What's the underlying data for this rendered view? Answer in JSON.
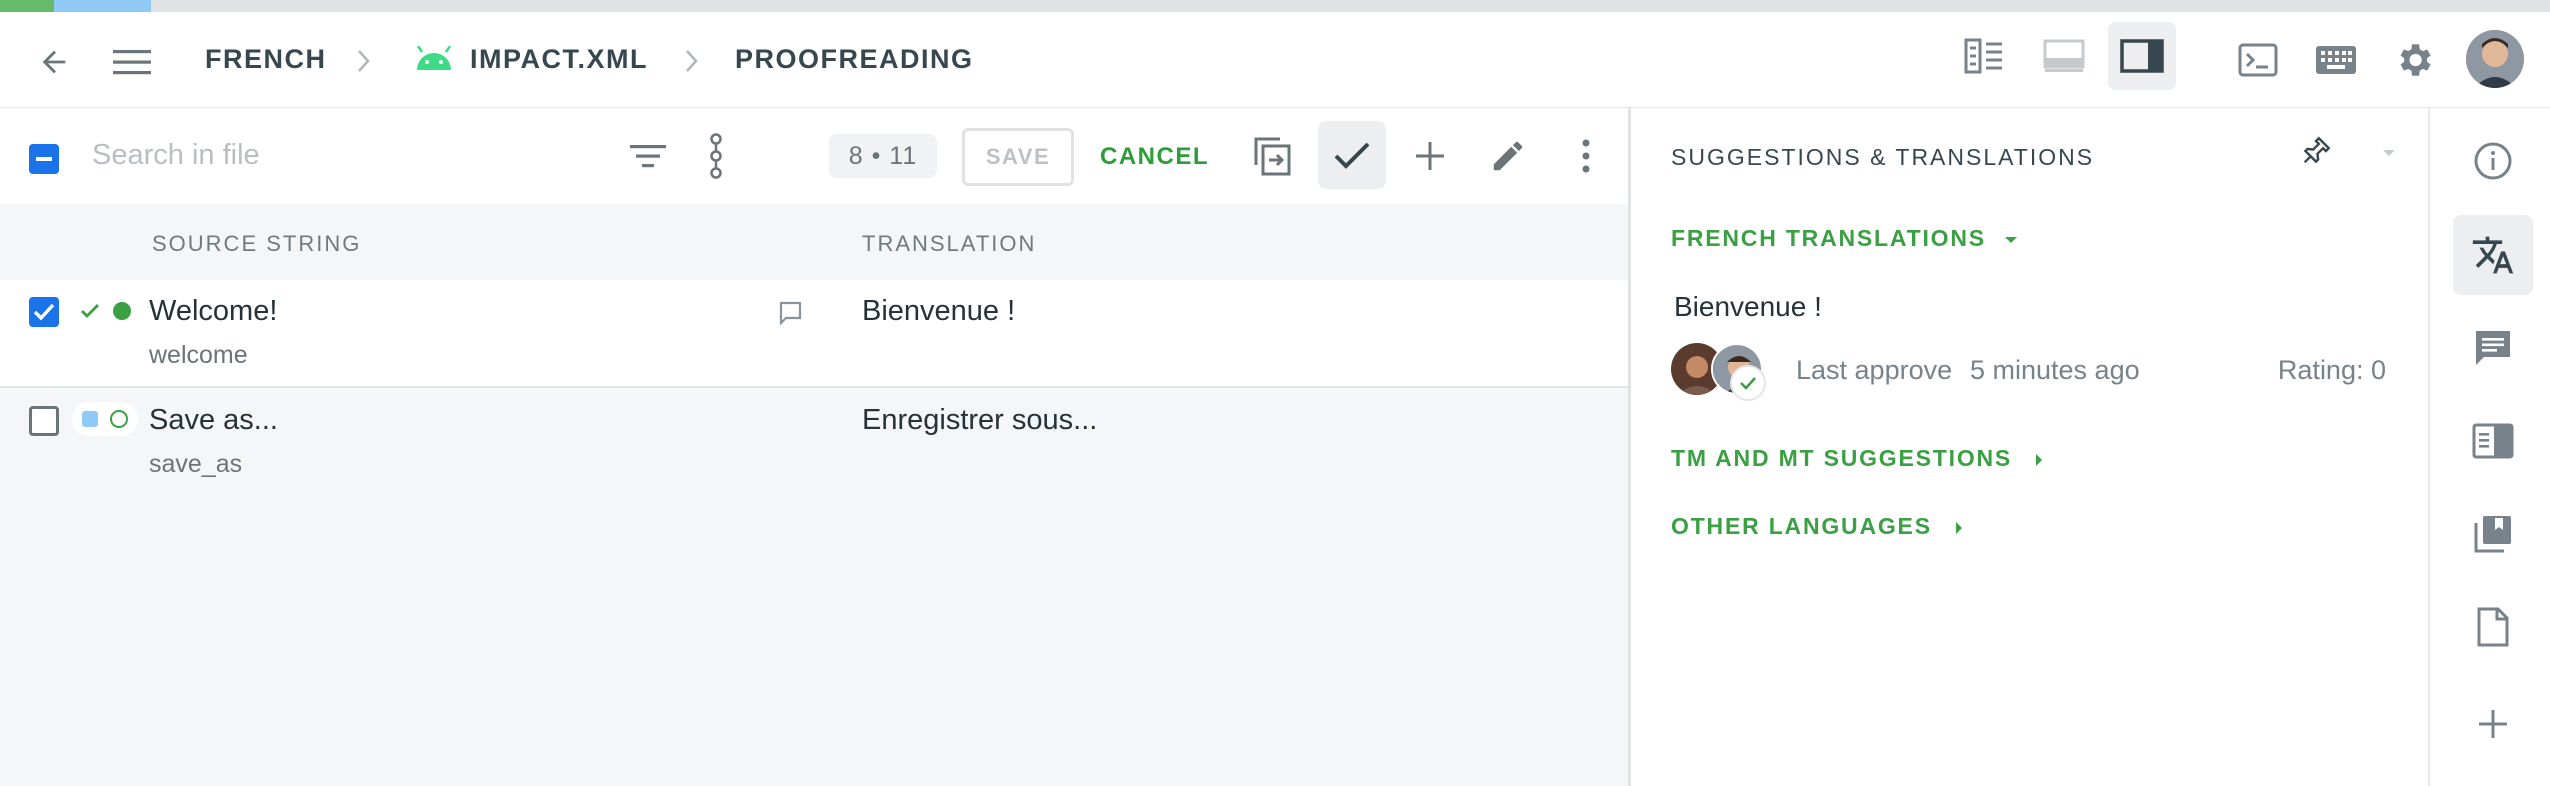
{
  "progress": {
    "translated_fraction": 0.021,
    "approved_fraction": 0.038
  },
  "breadcrumb": {
    "language": "FRENCH",
    "file": "IMPACT.XML",
    "step": "PROOFREADING"
  },
  "toolbar": {
    "search_placeholder": "Search in file",
    "counter": "8 • 11",
    "save_label": "SAVE",
    "cancel_label": "CANCEL"
  },
  "table": {
    "headers": {
      "source": "SOURCE STRING",
      "translation": "TRANSLATION"
    },
    "rows": [
      {
        "source": "Welcome!",
        "key": "welcome",
        "translation": "Bienvenue !",
        "checked": true
      },
      {
        "source": "Save as...",
        "key": "save_as",
        "translation": "Enregistrer sous...",
        "checked": false
      }
    ]
  },
  "panel": {
    "title": "SUGGESTIONS & TRANSLATIONS",
    "french_translations": "FRENCH TRANSLATIONS",
    "suggestion_text": "Bienvenue !",
    "approve_label": "Last approve",
    "approve_time": "5 minutes ago",
    "rating": "Rating: 0",
    "tm_mt": "TM AND MT SUGGESTIONS",
    "other_languages": "OTHER LANGUAGES"
  },
  "colors": {
    "accent_green": "#3aa043",
    "checkbox_blue": "#1a73e8",
    "android_green": "#3ddc84"
  },
  "icons": [
    "back-arrow-icon",
    "menu-icon",
    "android-icon",
    "side-by-side-icon",
    "horizontal-layout-icon",
    "sidebar-layout-icon",
    "console-icon",
    "keyboard-icon",
    "gear-icon",
    "avatar",
    "filter-icon",
    "workflow-icon",
    "copy-source-icon",
    "check-icon",
    "plus-icon",
    "pencil-icon",
    "kebab-icon",
    "comment-icon",
    "pin-icon",
    "info-icon",
    "translate-icon",
    "comments-icon",
    "glossary-icon",
    "tm-icon",
    "file-icon"
  ]
}
